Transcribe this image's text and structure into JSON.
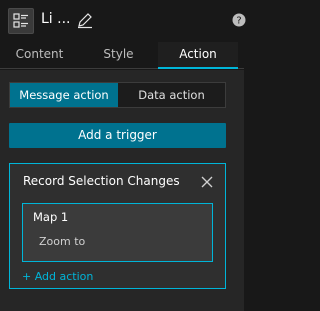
{
  "header": {
    "title": "Li ...",
    "widget_icon": "list-widget-icon",
    "edit_icon": "pencil-icon",
    "help_icon": "help-icon"
  },
  "tabs": [
    {
      "label": "Content",
      "active": false
    },
    {
      "label": "Style",
      "active": false
    },
    {
      "label": "Action",
      "active": true
    }
  ],
  "action_type": {
    "message_label": "Message action",
    "data_label": "Data action",
    "selected": "Message action"
  },
  "add_trigger_label": "Add a trigger",
  "trigger_card": {
    "title": "Record Selection Changes",
    "close_icon": "close-icon",
    "target": {
      "name": "Map 1",
      "action": "Zoom to"
    },
    "add_action_label": "+ Add action"
  },
  "colors": {
    "accent": "#00b5d8",
    "button_bg": "#00728f",
    "panel_bg": "#262626",
    "header_bg": "#181818"
  }
}
